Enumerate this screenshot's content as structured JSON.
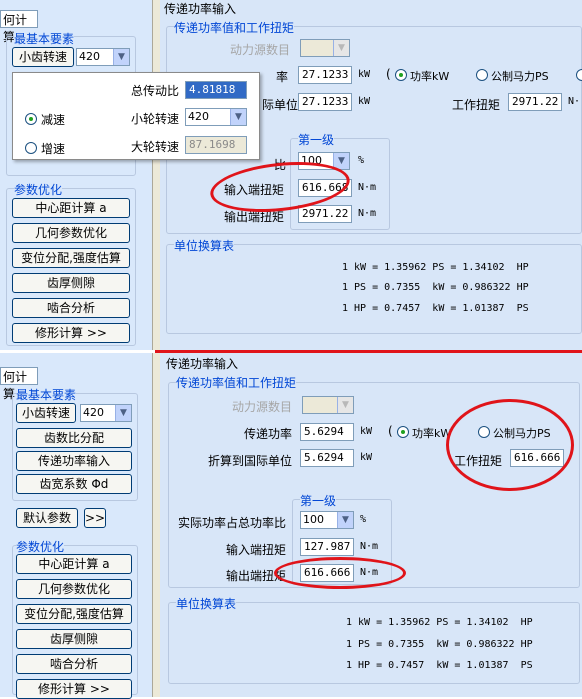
{
  "top": {
    "left_tab": "何计算",
    "basic_group": "最基本要素",
    "pinion_speed_btn": "小齿转速",
    "pinion_speed_value": "420",
    "popup": {
      "total_ratio_label": "总传动比",
      "total_ratio_value": "4.81818",
      "reduce_label": "减速",
      "increase_label": "增速",
      "small_speed_label": "小轮转速",
      "small_speed_value": "420",
      "big_speed_label": "大轮转速",
      "big_speed_value": "87.1698"
    },
    "param_group": "参数优化",
    "param_buttons": [
      "中心距计算 a",
      "几何参数优化",
      "变位分配,强度估算",
      "齿厚侧隙",
      "啮合分析",
      "修形计算  >>"
    ],
    "panel_title": "传递功率输入",
    "power_group": "传递功率值和工作扭矩",
    "power_source_label": "动力源数目",
    "power_label": "率",
    "power_value": "27.1233",
    "power_unit": "kW",
    "paren": "(",
    "radio_kw": "功率kW",
    "radio_ps": "公制马力PS",
    "si_label": "际单位",
    "si_value": "27.1233",
    "si_unit": "kW",
    "torque_label": "工作扭矩",
    "torque_value": "2971.22",
    "torque_unit": "N·",
    "stage_title": "第一级",
    "ratio_label": "比",
    "ratio_value": "100",
    "ratio_unit": "%",
    "in_torque_label": "输入端扭矩",
    "in_torque_value": "616.668",
    "in_torque_unit": "N·m",
    "out_torque_label": "输出端扭矩",
    "out_torque_value": "2971.22",
    "out_torque_unit": "N·m",
    "conv_title": "单位换算表",
    "conv_lines": [
      "1 kW = 1.35962 PS = 1.34102  HP",
      "1 PS = 0.7355  kW = 0.986322 HP",
      "1 HP = 0.7457  kW = 1.01387  PS"
    ]
  },
  "bottom": {
    "left_tab": "何计算",
    "basic_group": "最基本要素",
    "pinion_speed_btn": "小齿转速",
    "pinion_speed_value": "420",
    "basic_buttons": [
      "齿数比分配",
      "传递功率输入",
      "齿宽系数 Φd"
    ],
    "default_btn": "默认参数",
    "more_btn": ">>",
    "param_group": "参数优化",
    "param_buttons": [
      "中心距计算 a",
      "几何参数优化",
      "变位分配,强度估算",
      "齿厚侧隙",
      "啮合分析",
      "修形计算  >>"
    ],
    "panel_title": "传递功率输入",
    "power_group": "传递功率值和工作扭矩",
    "power_source_label": "动力源数目",
    "power_label": "传递功率",
    "power_value": "5.6294",
    "power_unit": "kW",
    "paren": "(",
    "radio_kw": "功率kW",
    "radio_ps": "公制马力PS",
    "si_label": "折算到国际单位",
    "si_value": "5.6294",
    "si_unit": "kW",
    "torque_label": "工作扭矩",
    "torque_value": "616.666",
    "stage_title": "第一级",
    "ratio_label": "实际功率占总功率比",
    "ratio_value": "100",
    "ratio_unit": "%",
    "in_torque_label": "输入端扭矩",
    "in_torque_value": "127.987",
    "in_torque_unit": "N·m",
    "out_torque_label": "输出端扭矩",
    "out_torque_value": "616.666",
    "out_torque_unit": "N·m",
    "conv_title": "单位换算表",
    "conv_lines": [
      "1 kW = 1.35962 PS = 1.34102  HP",
      "1 PS = 0.7355  kW = 0.986322 HP",
      "1 HP = 0.7457  kW = 1.01387  PS"
    ]
  },
  "colors": {
    "annotation": "#e0141a",
    "group_title": "#0046d5",
    "left_bg": "#d9e8fb",
    "right_bg": "#d8e6f8"
  }
}
